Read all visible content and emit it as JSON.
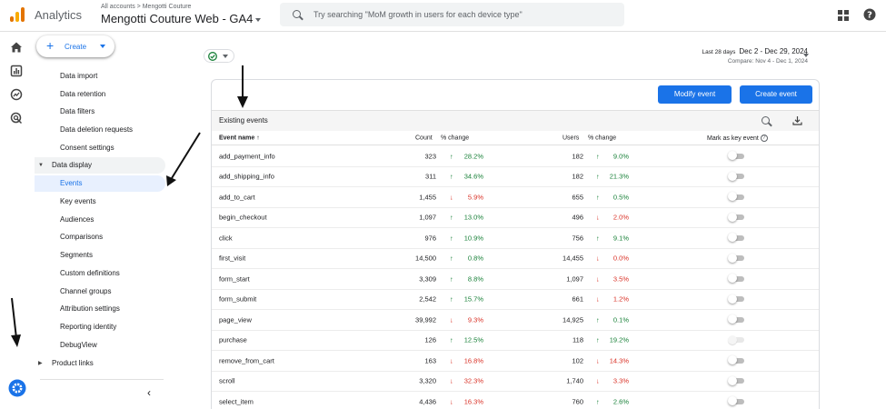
{
  "topbar": {
    "app_name": "Analytics",
    "account_crumb": "All accounts > Mengotti Couture",
    "property_name": "Mengotti Couture Web - GA4",
    "search_placeholder": "Try searching \"MoM growth in users for each device type\""
  },
  "sidebar": {
    "create_label": "Create",
    "items_top": [
      "Data import",
      "Data retention",
      "Data filters",
      "Data deletion requests",
      "Consent settings"
    ],
    "section_label": "Data display",
    "items_display": [
      "Events",
      "Key events",
      "Audiences",
      "Comparisons",
      "Segments",
      "Custom definitions",
      "Channel groups",
      "Attribution settings",
      "Reporting identity",
      "DebugView"
    ],
    "active_item": "Events",
    "section2_label": "Product links"
  },
  "daterange": {
    "label": "Last 28 days",
    "range": "Dec 2 - Dec 29, 2024",
    "compare": "Compare: Nov 4 - Dec 1, 2024"
  },
  "card": {
    "modify_label": "Modify event",
    "create_label": "Create event",
    "title": "Existing events",
    "columns": {
      "name": "Event name",
      "count": "Count",
      "change": "% change",
      "users": "Users",
      "users_change": "% change",
      "key": "Mark as key event"
    },
    "rows": [
      {
        "name": "add_payment_info",
        "count": "323",
        "cdir": "up",
        "cpct": "28.2%",
        "users": "182",
        "udir": "up",
        "upct": "9.0%",
        "key": "off"
      },
      {
        "name": "add_shipping_info",
        "count": "311",
        "cdir": "up",
        "cpct": "34.6%",
        "users": "182",
        "udir": "up",
        "upct": "21.3%",
        "key": "off"
      },
      {
        "name": "add_to_cart",
        "count": "1,455",
        "cdir": "down",
        "cpct": "5.9%",
        "users": "655",
        "udir": "up",
        "upct": "0.5%",
        "key": "off"
      },
      {
        "name": "begin_checkout",
        "count": "1,097",
        "cdir": "up",
        "cpct": "13.0%",
        "users": "496",
        "udir": "down",
        "upct": "2.0%",
        "key": "off"
      },
      {
        "name": "click",
        "count": "976",
        "cdir": "up",
        "cpct": "10.9%",
        "users": "756",
        "udir": "up",
        "upct": "9.1%",
        "key": "off"
      },
      {
        "name": "first_visit",
        "count": "14,500",
        "cdir": "up",
        "cpct": "0.8%",
        "users": "14,455",
        "udir": "down",
        "upct": "0.0%",
        "key": "off"
      },
      {
        "name": "form_start",
        "count": "3,309",
        "cdir": "up",
        "cpct": "8.8%",
        "users": "1,097",
        "udir": "down",
        "upct": "3.5%",
        "key": "off"
      },
      {
        "name": "form_submit",
        "count": "2,542",
        "cdir": "up",
        "cpct": "15.7%",
        "users": "661",
        "udir": "down",
        "upct": "1.2%",
        "key": "off"
      },
      {
        "name": "page_view",
        "count": "39,992",
        "cdir": "down",
        "cpct": "9.3%",
        "users": "14,925",
        "udir": "up",
        "upct": "0.1%",
        "key": "off"
      },
      {
        "name": "purchase",
        "count": "126",
        "cdir": "up",
        "cpct": "12.5%",
        "users": "118",
        "udir": "up",
        "upct": "19.2%",
        "key": "disabled"
      },
      {
        "name": "remove_from_cart",
        "count": "163",
        "cdir": "down",
        "cpct": "16.8%",
        "users": "102",
        "udir": "down",
        "upct": "14.3%",
        "key": "off"
      },
      {
        "name": "scroll",
        "count": "3,320",
        "cdir": "down",
        "cpct": "32.3%",
        "users": "1,740",
        "udir": "down",
        "upct": "3.3%",
        "key": "off"
      },
      {
        "name": "select_item",
        "count": "4,436",
        "cdir": "down",
        "cpct": "16.3%",
        "users": "760",
        "udir": "up",
        "upct": "2.6%",
        "key": "off"
      }
    ]
  },
  "glyphs": {
    "up": "↑",
    "down": "↓",
    "sort": "↑",
    "q": "?"
  },
  "colors": {
    "accent": "#1a73e8",
    "up": "#188038",
    "down": "#d93025",
    "active_bg": "#e8f0fe"
  }
}
